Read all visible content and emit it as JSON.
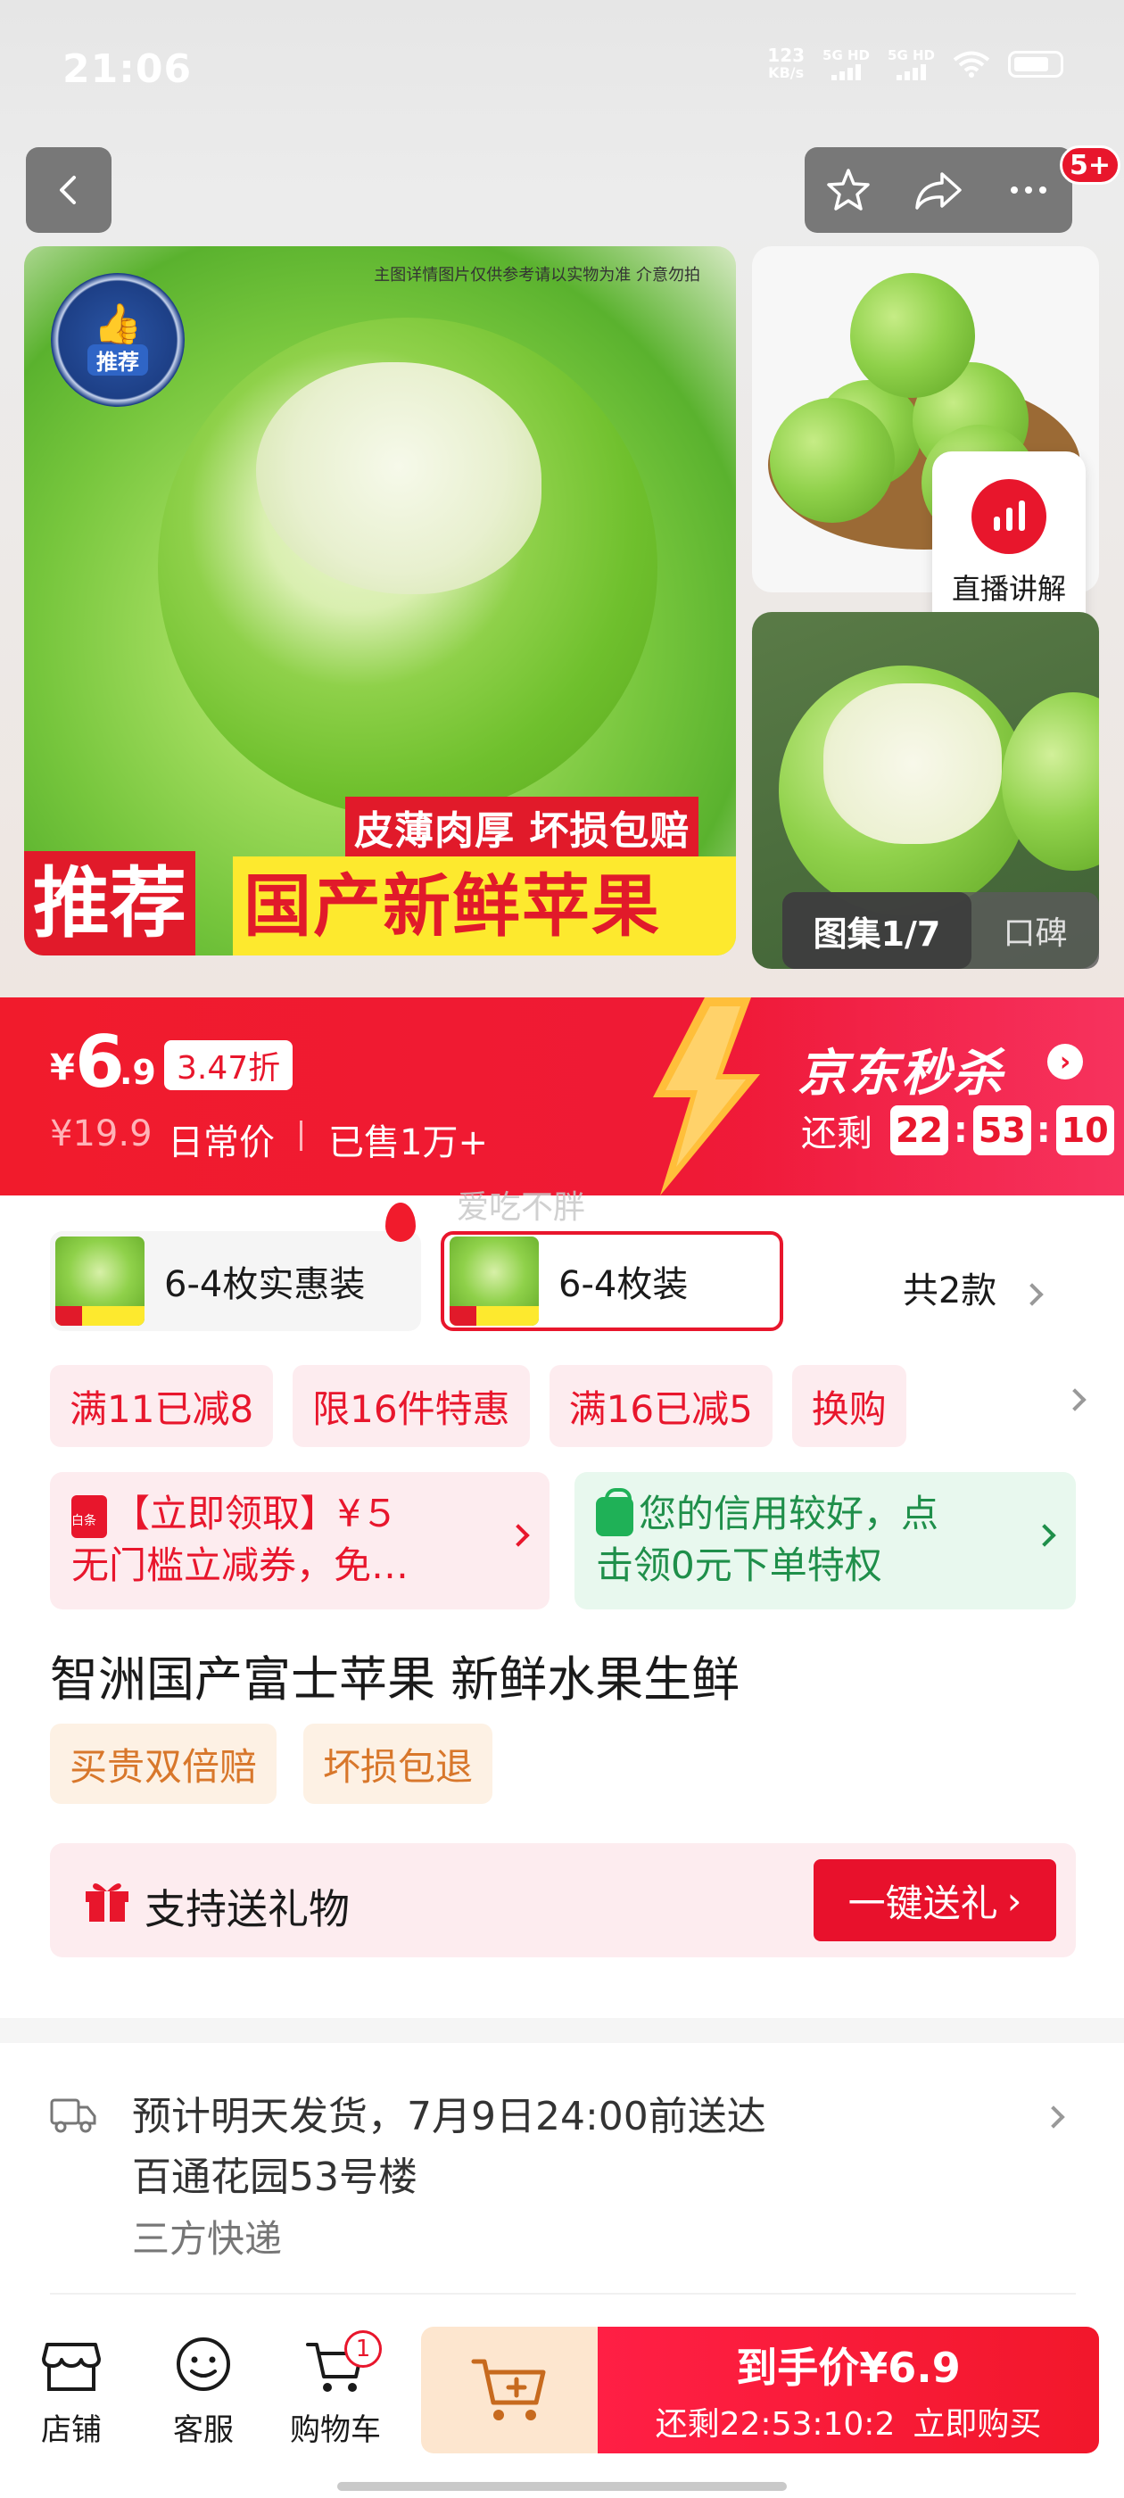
{
  "status_bar": {
    "time": "21:06",
    "net_speed_value": "123",
    "net_speed_unit": "KB/s",
    "sim1": "5G HD",
    "sim2": "5G HD"
  },
  "header": {
    "back_icon": "chevron-left-icon",
    "favorite_icon": "star-icon",
    "share_icon": "share-arrow-icon",
    "more_icon": "more-dots-icon",
    "message_badge": "5+"
  },
  "gallery": {
    "disclaimer": "主图详情图片仅供参考请以实物为准 介意勿拍",
    "seal_text": "推荐",
    "slogan": "皮薄肉厚 坏损包赔",
    "banner_left": "推荐",
    "banner_right": "国产新鲜苹果",
    "live_label": "直播讲解",
    "gallery_counter": "图集1/7",
    "reviews_tab": "口碑"
  },
  "flash_sale": {
    "currency": "¥",
    "price_int": "6",
    "price_dec": ".9",
    "discount": "3.47折",
    "original_price": "¥19.9",
    "original_label": "日常价",
    "sold": "已售1万+",
    "title": "京东秒杀",
    "countdown_label": "还剩",
    "hours": "22",
    "minutes": "53",
    "seconds": "10",
    "colors": {
      "red": "#ef1a35",
      "bolt": "#ffbf3a"
    }
  },
  "watermark": "爱吃不胖",
  "sku": {
    "options": [
      {
        "label": "6-4枚实惠装",
        "selected": false
      },
      {
        "label": "6-4枚装",
        "selected": true
      }
    ],
    "total": "共2款"
  },
  "promotions": [
    "满11已减8",
    "限16件特惠",
    "满16已减5",
    "换购"
  ],
  "coupons": {
    "red": {
      "line1": "【立即领取】¥５",
      "line2": "无门槛立减券，免…",
      "icon_text": "白条"
    },
    "green": {
      "line1": "您的信用较好，点",
      "line2": "击领0元下单特权"
    }
  },
  "product": {
    "title": "智洲国产富士苹果 新鲜水果生鲜",
    "tags": [
      "买贵双倍赔",
      "坏损包退"
    ]
  },
  "gift": {
    "label": "支持送礼物",
    "button": "一键送礼"
  },
  "shipping": {
    "eta": "预计明天发货，7月9日24:00前送达",
    "address": "百通花园53号楼",
    "carrier": "三方快递"
  },
  "bottom_bar": {
    "store": "店铺",
    "service": "客服",
    "cart": "购物车",
    "cart_count": "1",
    "buy_price": "到手价¥6.9",
    "buy_countdown": "还剩22:53:10:2",
    "buy_label": "立即购买"
  }
}
